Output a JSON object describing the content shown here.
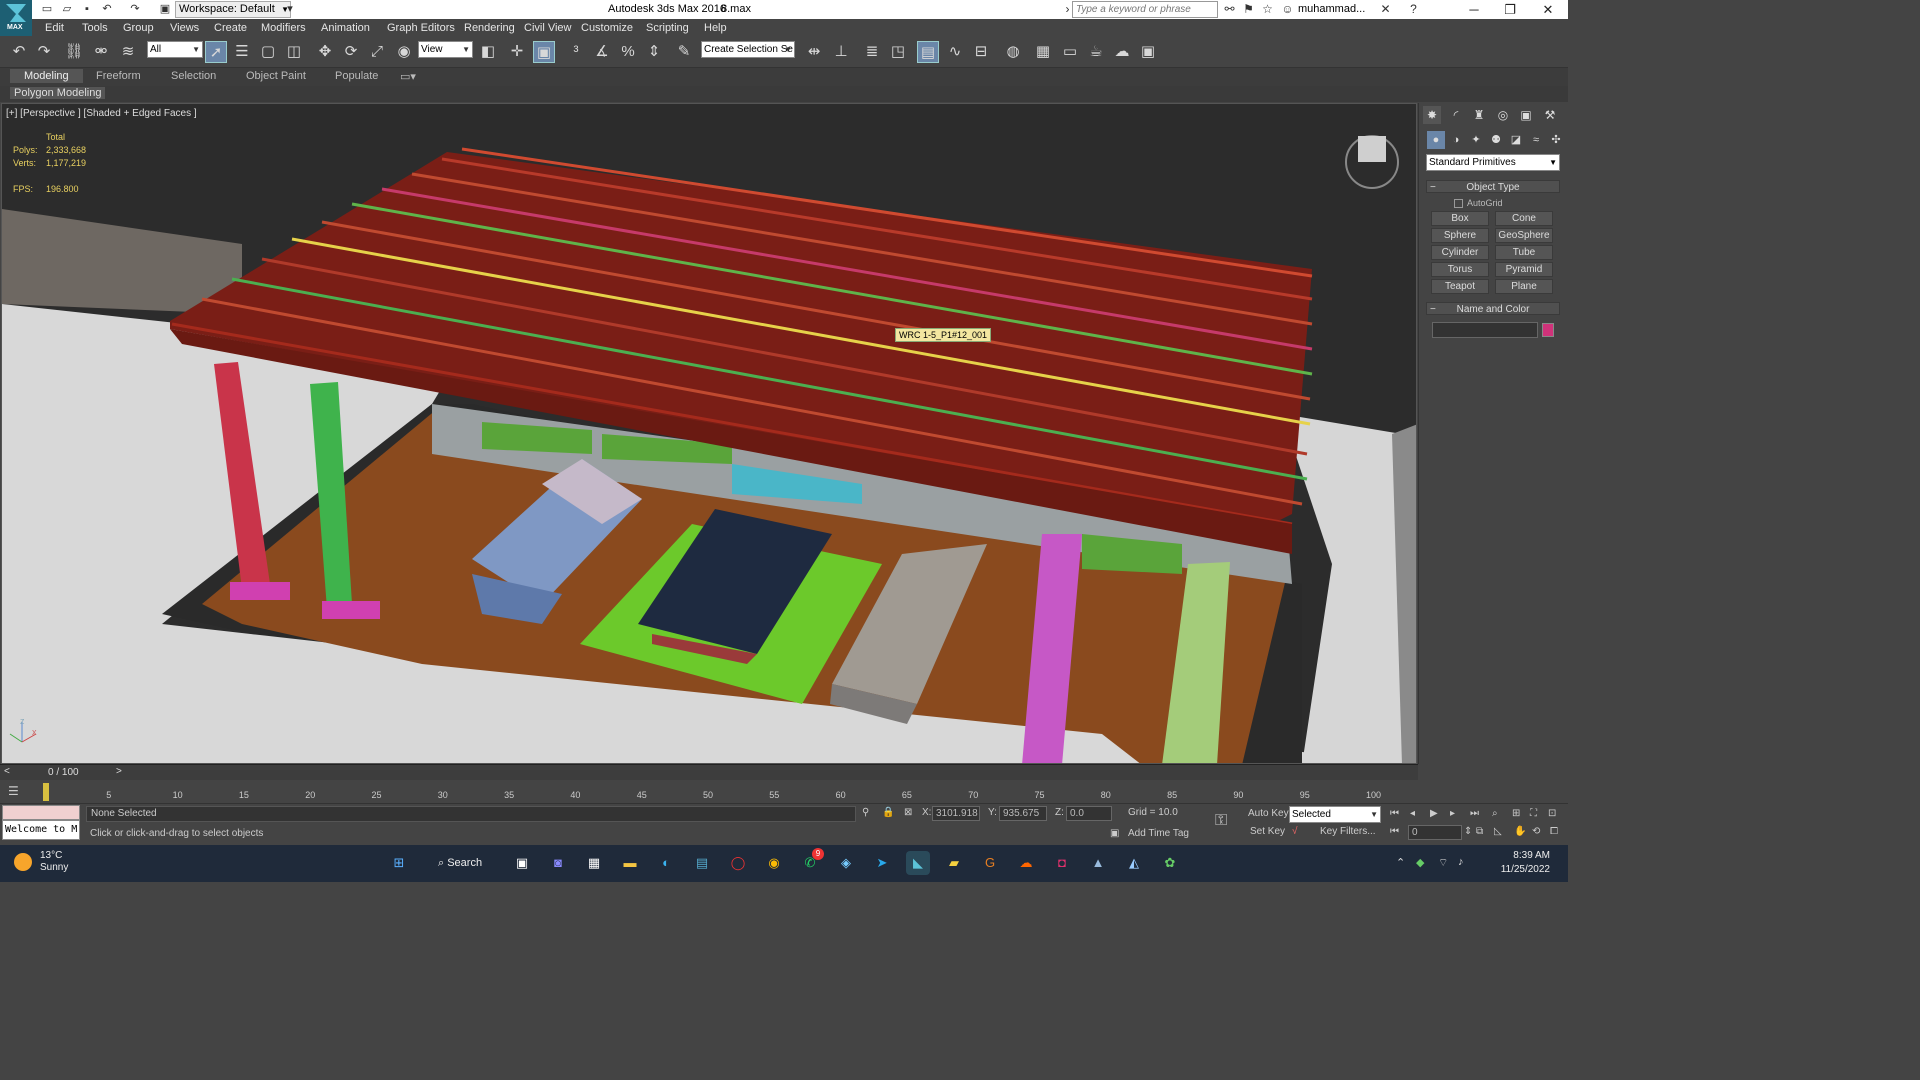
{
  "titlebar": {
    "workspace": "Workspace: Default",
    "app_title": "Autodesk 3ds Max 2016",
    "file_name": "8.max",
    "search_placeholder": "Type a keyword or phrase",
    "user": "muhammad...",
    "logo_text": "MAX"
  },
  "menu": [
    "Edit",
    "Tools",
    "Group",
    "Views",
    "Create",
    "Modifiers",
    "Animation",
    "Graph Editors",
    "Rendering",
    "Civil View",
    "Customize",
    "Scripting",
    "Help"
  ],
  "toolbar": {
    "filter": "All",
    "ref_coord": "View",
    "selection_set": "Create Selection Se"
  },
  "ribbon": {
    "tabs": [
      "Modeling",
      "Freeform",
      "Selection",
      "Object Paint",
      "Populate"
    ],
    "panel": "Polygon Modeling"
  },
  "viewport": {
    "label": "[+] [Perspective ] [Shaded + Edged Faces ]",
    "stats": {
      "total_label": "Total",
      "polys_label": "Polys:",
      "polys": "2,333,668",
      "verts_label": "Verts:",
      "verts": "1,177,219",
      "fps_label": "FPS:",
      "fps": "196.800"
    },
    "tooltip": "WRC 1-5_P1#12_001",
    "axis_z": "z",
    "axis_x": "x"
  },
  "command_panel": {
    "category": "Standard Primitives",
    "object_type_title": "Object Type",
    "autogrid": "AutoGrid",
    "buttons": [
      "Box",
      "Cone",
      "Sphere",
      "GeoSphere",
      "Cylinder",
      "Tube",
      "Torus",
      "Pyramid",
      "Teapot",
      "Plane"
    ],
    "name_color_title": "Name and Color",
    "object_color": "#d0327a"
  },
  "timeline": {
    "frame": "0 / 100",
    "ticks": [
      "5",
      "10",
      "15",
      "20",
      "25",
      "30",
      "35",
      "40",
      "45",
      "50",
      "55",
      "60",
      "65",
      "70",
      "75",
      "80",
      "85",
      "90",
      "95",
      "100"
    ]
  },
  "status": {
    "maxscript": "Welcome to M",
    "selection": "None Selected",
    "prompt": "Click or click-and-drag to select objects",
    "x_label": "X:",
    "x": "3101.918",
    "y_label": "Y:",
    "y": "935.675",
    "z_label": "Z:",
    "z": "0.0",
    "grid": "Grid = 10.0",
    "auto_key": "Auto Key",
    "set_key": "Set Key",
    "key_mode": "Selected",
    "key_filters": "Key Filters...",
    "add_time_tag": "Add Time Tag",
    "current_frame": "0"
  },
  "taskbar": {
    "temp": "13°C",
    "condition": "Sunny",
    "search": "Search",
    "time": "8:39 AM",
    "date": "11/25/2022",
    "badge": "9"
  }
}
